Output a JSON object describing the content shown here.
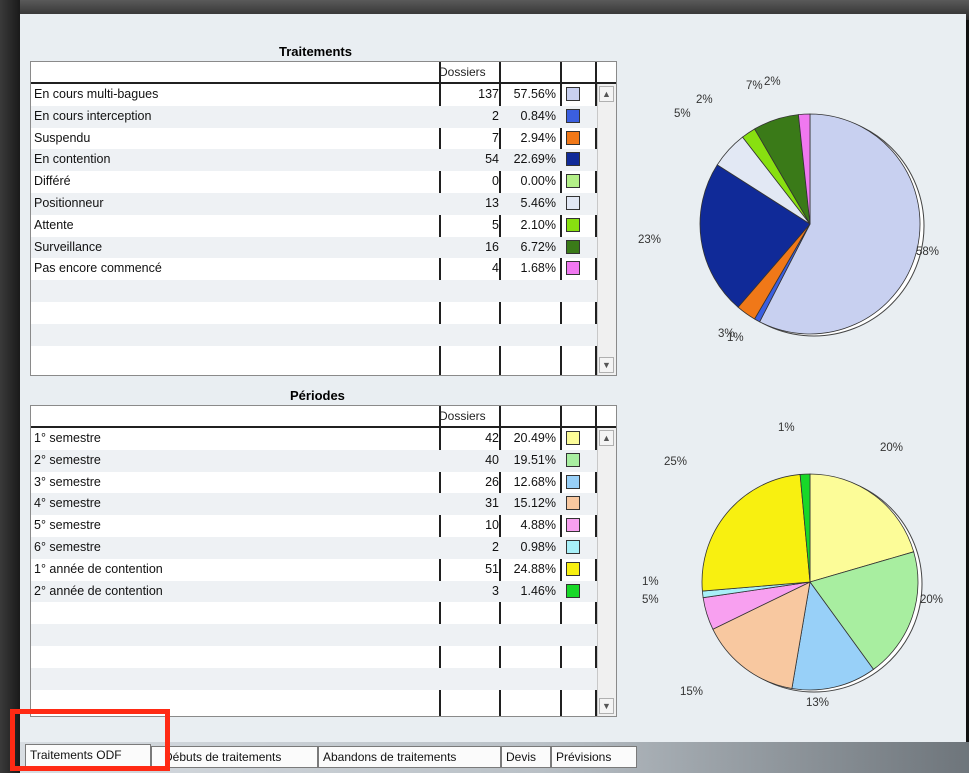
{
  "traitements": {
    "title": "Traitements",
    "header": "Dossiers",
    "rows": [
      {
        "label": "En cours multi-bagues",
        "count": "137",
        "pct": "57.56%",
        "color": "#c8d0f0",
        "value": 57.56
      },
      {
        "label": "En cours interception",
        "count": "2",
        "pct": "0.84%",
        "color": "#3b5fe0",
        "value": 0.84
      },
      {
        "label": "Suspendu",
        "count": "7",
        "pct": "2.94%",
        "color": "#f07818",
        "value": 2.94
      },
      {
        "label": "En contention",
        "count": "54",
        "pct": "22.69%",
        "color": "#102a98",
        "value": 22.69
      },
      {
        "label": "Différé",
        "count": "0",
        "pct": "0.00%",
        "color": "#b4f088",
        "value": 0.0
      },
      {
        "label": "Positionneur",
        "count": "13",
        "pct": "5.46%",
        "color": "#e2e8f4",
        "value": 5.46
      },
      {
        "label": "Attente",
        "count": "5",
        "pct": "2.10%",
        "color": "#88e010",
        "value": 2.1
      },
      {
        "label": "Surveillance",
        "count": "16",
        "pct": "6.72%",
        "color": "#3a7a18",
        "value": 6.72
      },
      {
        "label": "Pas encore commencé",
        "count": "4",
        "pct": "1.68%",
        "color": "#f078f0",
        "value": 1.68
      }
    ],
    "pie_labels": [
      "58%",
      "1%",
      "3%",
      "23%",
      "5%",
      "2%",
      "7%",
      "2%"
    ]
  },
  "periodes": {
    "title": "Périodes",
    "header": "Dossiers",
    "rows": [
      {
        "label": "1° semestre",
        "count": "42",
        "pct": "20.49%",
        "color": "#fcfc98",
        "value": 20.49
      },
      {
        "label": "2° semestre",
        "count": "40",
        "pct": "19.51%",
        "color": "#a8eea0",
        "value": 19.51
      },
      {
        "label": "3° semestre",
        "count": "26",
        "pct": "12.68%",
        "color": "#98d0f8",
        "value": 12.68
      },
      {
        "label": "4° semestre",
        "count": "31",
        "pct": "15.12%",
        "color": "#f8c8a0",
        "value": 15.12
      },
      {
        "label": "5° semestre",
        "count": "10",
        "pct": "4.88%",
        "color": "#f8a0f0",
        "value": 4.88
      },
      {
        "label": "6° semestre",
        "count": "2",
        "pct": "0.98%",
        "color": "#a8f0f8",
        "value": 0.98
      },
      {
        "label": "1° année de contention",
        "count": "51",
        "pct": "24.88%",
        "color": "#f8f010",
        "value": 24.88
      },
      {
        "label": "2° année de contention",
        "count": "3",
        "pct": "1.46%",
        "color": "#18d828",
        "value": 1.46
      }
    ],
    "pie_labels": [
      "20%",
      "20%",
      "13%",
      "15%",
      "5%",
      "1%",
      "25%",
      "1%"
    ]
  },
  "tabs": [
    "Traitements ODF",
    "Débuts de traitements",
    "Abandons de traitements",
    "Devis",
    "Prévisions"
  ],
  "scroll": {
    "up": "▲",
    "down": "▼"
  },
  "highlight_color": "#ff2a14"
}
